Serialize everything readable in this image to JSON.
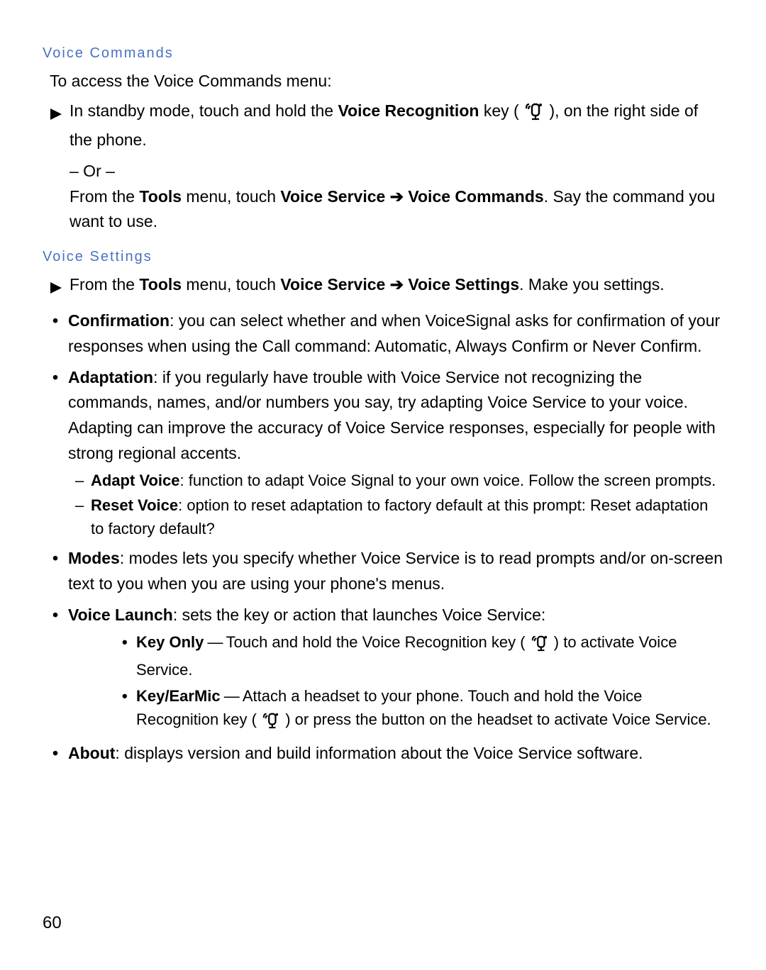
{
  "page_number": "60",
  "sections": {
    "voice_commands": {
      "heading": "Voice Commands",
      "intro": "To access the Voice Commands menu:",
      "step_pre": "In standby mode, touch and hold the ",
      "step_bold": "Voice Recognition",
      "step_post": " key ( ",
      "step_post2": " ), on the right side of the phone.",
      "or": "– Or –",
      "step2_from": "From the ",
      "step2_tools": "Tools",
      "step2_mid": " menu, touch ",
      "step2_vservice": "Voice Service",
      "step2_arrow": " ➔ ",
      "step2_vcommands": "Voice Commands",
      "step2_end": ". Say the command you want to use."
    },
    "voice_settings": {
      "heading": "Voice Settings",
      "step_from": "From the ",
      "step_tools": "Tools",
      "step_mid": " menu, touch ",
      "step_vservice": "Voice Service",
      "step_arrow": " ➔ ",
      "step_vsettings": "Voice Settings",
      "step_end": ". Make you settings.",
      "items": {
        "confirmation": {
          "label": "Confirmation",
          "text": ": you can select whether and when VoiceSignal asks for confirmation of your responses when using the Call command: Automatic, Always Confirm or Never Confirm."
        },
        "adaptation": {
          "label": "Adaptation",
          "text": ": if you regularly have trouble with Voice Service not recognizing the commands, names, and/or numbers you say, try adapting Voice Service to your voice. Adapting can improve the accuracy of Voice Service responses, especially for people with strong regional accents.",
          "sub": {
            "adapt": {
              "label": "Adapt Voice",
              "text": ": function to adapt Voice Signal to your own voice. Follow the screen prompts."
            },
            "reset": {
              "label": "Reset Voice",
              "text": ": option to reset adaptation to factory default at this prompt: Reset adaptation to factory default?"
            }
          }
        },
        "modes": {
          "label": "Modes",
          "text": ": modes lets you specify whether Voice Service is to read prompts and/or on-screen text to you when you are using your phone's menus."
        },
        "voice_launch": {
          "label": "Voice Launch",
          "text": ": sets the key or action that launches Voice Service:",
          "sub": {
            "key_only": {
              "label": "Key Only",
              "dash": " — ",
              "pre": "Touch and hold the Voice Recognition key ( ",
              "post": " ) to activate Voice Service."
            },
            "key_earmic": {
              "label": "Key/EarMic",
              "dash": " — ",
              "pre": "Attach a headset to your phone. Touch and hold the Voice Recognition key ( ",
              "post": " ) or press the button on the headset to activate Voice Service."
            }
          }
        },
        "about": {
          "label": "About",
          "text": ": displays version and build information about the Voice Service software."
        }
      }
    }
  }
}
